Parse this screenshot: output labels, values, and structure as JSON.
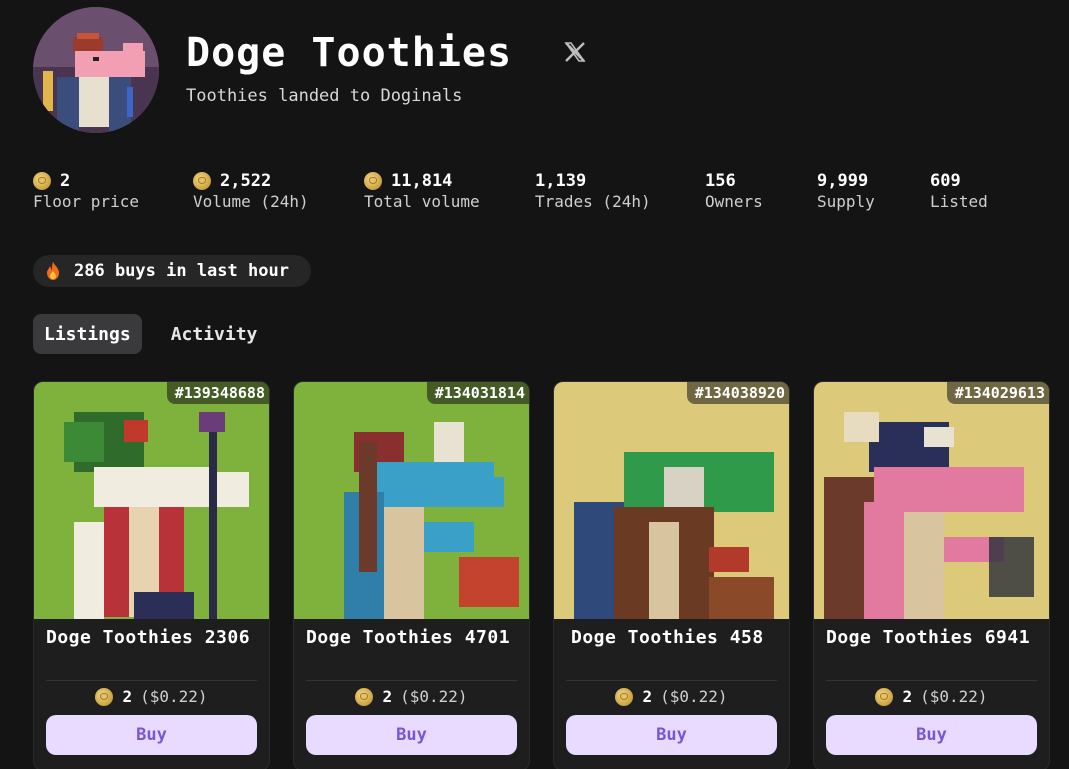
{
  "collection": {
    "title": "Doge Toothies",
    "subtitle": "Toothies landed to Doginals"
  },
  "stats": [
    {
      "value": "2",
      "label": "Floor price",
      "icon": "dogecoin-icon"
    },
    {
      "value": "2,522",
      "label": "Volume (24h)",
      "icon": "dogecoin-icon"
    },
    {
      "value": "11,814",
      "label": "Total volume",
      "icon": "dogecoin-icon"
    },
    {
      "value": "1,139",
      "label": "Trades (24h)"
    },
    {
      "value": "156",
      "label": "Owners"
    },
    {
      "value": "9,999",
      "label": "Supply"
    },
    {
      "value": "609",
      "label": "Listed"
    }
  ],
  "activity_badge": {
    "text": "286 buys in last hour",
    "icon": "fire-icon"
  },
  "tabs": [
    {
      "label": "Listings",
      "active": true
    },
    {
      "label": "Activity",
      "active": false
    }
  ],
  "listings": [
    {
      "inscription": "#139348688",
      "name": "Doge Toothies 2306",
      "price": "2",
      "usd": "($0.22)",
      "buy_label": "Buy",
      "bg": "#7fb23d"
    },
    {
      "inscription": "#134031814",
      "name": "Doge Toothies 4701",
      "price": "2",
      "usd": "($0.22)",
      "buy_label": "Buy",
      "bg": "#7fb23d"
    },
    {
      "inscription": "#134038920",
      "name": "Doge Toothies 458",
      "price": "2",
      "usd": "($0.22)",
      "buy_label": "Buy",
      "bg": "#ddc97a"
    },
    {
      "inscription": "#134029613",
      "name": "Doge Toothies 6941",
      "price": "2",
      "usd": "($0.22)",
      "buy_label": "Buy",
      "bg": "#ddc97a"
    }
  ],
  "colors": {
    "background": "#141414",
    "buy_button_bg": "#e8dbff",
    "buy_button_text": "#7b55d8",
    "tab_active_bg": "#3a3a3c"
  }
}
